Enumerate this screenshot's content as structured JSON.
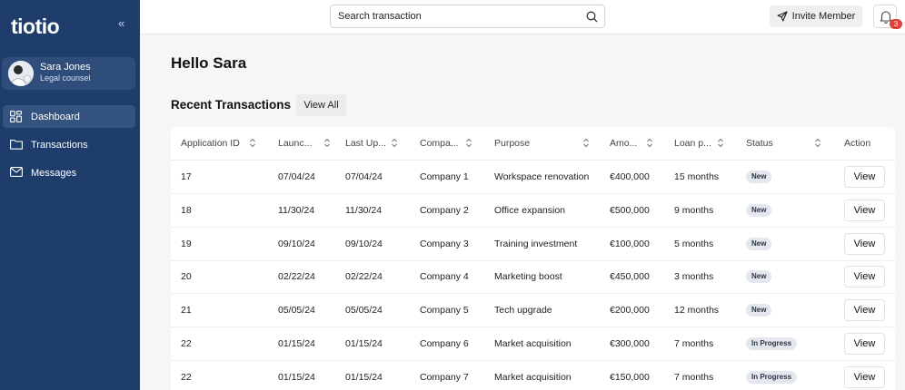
{
  "sidebar": {
    "logo": "tiotio",
    "collapse_icon": "«",
    "user": {
      "name": "Sara Jones",
      "role": "Legal counsel"
    },
    "items": [
      {
        "label": "Dashboard",
        "icon": "dashboard-grid-icon",
        "active": true
      },
      {
        "label": "Transactions",
        "icon": "folder-icon",
        "active": false
      },
      {
        "label": "Messages",
        "icon": "mail-icon",
        "active": false
      }
    ]
  },
  "topbar": {
    "search_placeholder": "Search transaction",
    "invite_label": "Invite Member",
    "notification_count": "3"
  },
  "main": {
    "greeting": "Hello Sara",
    "section_title": "Recent Transactions",
    "view_all_label": "View All"
  },
  "table": {
    "columns": [
      "Application ID",
      "Launc...",
      "Last Up...",
      "Compa...",
      "Purpose",
      "Amo...",
      "Loan p...",
      "Status",
      "Action"
    ],
    "rows": [
      {
        "id": "17",
        "launch": "07/04/24",
        "last_update": "07/04/24",
        "company": "Company 1",
        "purpose": "Workspace renovation",
        "amount": "€400,000",
        "loan_period": "15 months",
        "status": "New",
        "action": "View"
      },
      {
        "id": "18",
        "launch": "11/30/24",
        "last_update": "11/30/24",
        "company": "Company 2",
        "purpose": "Office expansion",
        "amount": "€500,000",
        "loan_period": "9 months",
        "status": "New",
        "action": "View"
      },
      {
        "id": "19",
        "launch": "09/10/24",
        "last_update": "09/10/24",
        "company": "Company 3",
        "purpose": "Training investment",
        "amount": "€100,000",
        "loan_period": "5 months",
        "status": "New",
        "action": "View"
      },
      {
        "id": "20",
        "launch": "02/22/24",
        "last_update": "02/22/24",
        "company": "Company 4",
        "purpose": "Marketing boost",
        "amount": "€450,000",
        "loan_period": "3 months",
        "status": "New",
        "action": "View"
      },
      {
        "id": "21",
        "launch": "05/05/24",
        "last_update": "05/05/24",
        "company": "Company 5",
        "purpose": "Tech upgrade",
        "amount": "€200,000",
        "loan_period": "12 months",
        "status": "New",
        "action": "View"
      },
      {
        "id": "22",
        "launch": "01/15/24",
        "last_update": "01/15/24",
        "company": "Company 6",
        "purpose": "Market acquisition",
        "amount": "€300,000",
        "loan_period": "7 months",
        "status": "In Progress",
        "action": "View"
      },
      {
        "id": "22",
        "launch": "01/15/24",
        "last_update": "01/15/24",
        "company": "Company 7",
        "purpose": "Market acquisition",
        "amount": "€150,000",
        "loan_period": "7 months",
        "status": "In Progress",
        "action": "View"
      }
    ]
  }
}
